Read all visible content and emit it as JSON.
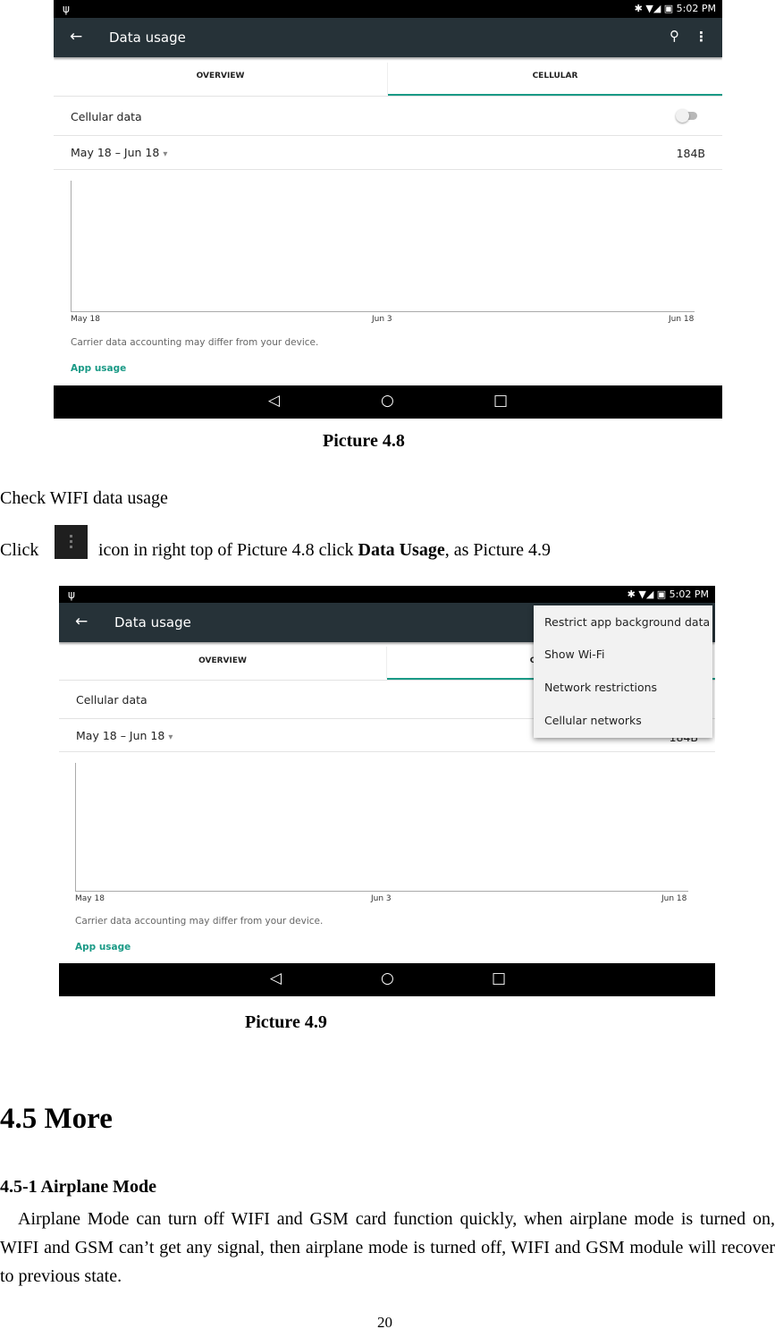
{
  "picture1": {
    "status": {
      "usb_icon": "usb-icon",
      "time": "5:02 PM",
      "icons": "✱ ▼◢ ▣"
    },
    "toolbar": {
      "back_icon": "←",
      "title": "Data usage",
      "search_icon": "⚲",
      "more_icon": "⋮"
    },
    "tabs": [
      {
        "label": "OVERVIEW"
      },
      {
        "label": "CELLULAR",
        "selected": true
      }
    ],
    "cellular_data": {
      "label": "Cellular data",
      "enabled": false
    },
    "cycle": {
      "label": "May 18 – Jun 18",
      "arrow": "▾",
      "usage": "184B"
    },
    "chart": {
      "x_ticks": [
        "May 18",
        "Jun 3",
        "Jun 18"
      ]
    },
    "note": "Carrier data accounting may differ from your device.",
    "app_usage": "App usage",
    "nav": {
      "back": "◁",
      "home": "○",
      "recents": "□"
    }
  },
  "caption1": "Picture 4.8",
  "check_wifi": "Check WIFI data usage",
  "click_line": {
    "before": "Click",
    "after": "icon in right top of Picture 4.8 click ",
    "bold": "Data Usage",
    "end": ", as Picture 4.9"
  },
  "picture2": {
    "status": {
      "usb_icon": "usb-icon",
      "time": "5:02 PM",
      "icons": "✱ ▼◢ ▣"
    },
    "toolbar": {
      "back_icon": "←",
      "title": "Data usage"
    },
    "tabs": [
      {
        "label": "OVERVIEW"
      },
      {
        "label": "C",
        "selected": true
      }
    ],
    "cellular_data": {
      "label": "Cellular data"
    },
    "cycle": {
      "label": "May 18 – Jun 18",
      "arrow": "▾",
      "usage": "184B"
    },
    "chart": {
      "x_ticks": [
        "May 18",
        "Jun 3",
        "Jun 18"
      ]
    },
    "note": "Carrier data accounting may differ from your device.",
    "app_usage": "App usage",
    "menu": [
      "Restrict app background data",
      "Show Wi-Fi",
      "Network restrictions",
      "Cellular networks"
    ],
    "nav": {
      "back": "◁",
      "home": "○",
      "recents": "□"
    }
  },
  "caption2": "Picture 4.9",
  "section": "4.5 More",
  "subsection": "4.5-1 Airplane Mode",
  "paragraph": "Airplane Mode can turn off WIFI and GSM card function quickly, when airplane mode is turned on, WIFI and GSM can’t get any signal, then airplane mode is turned off, WIFI and GSM module will recover to previous state.",
  "page_number": "20"
}
